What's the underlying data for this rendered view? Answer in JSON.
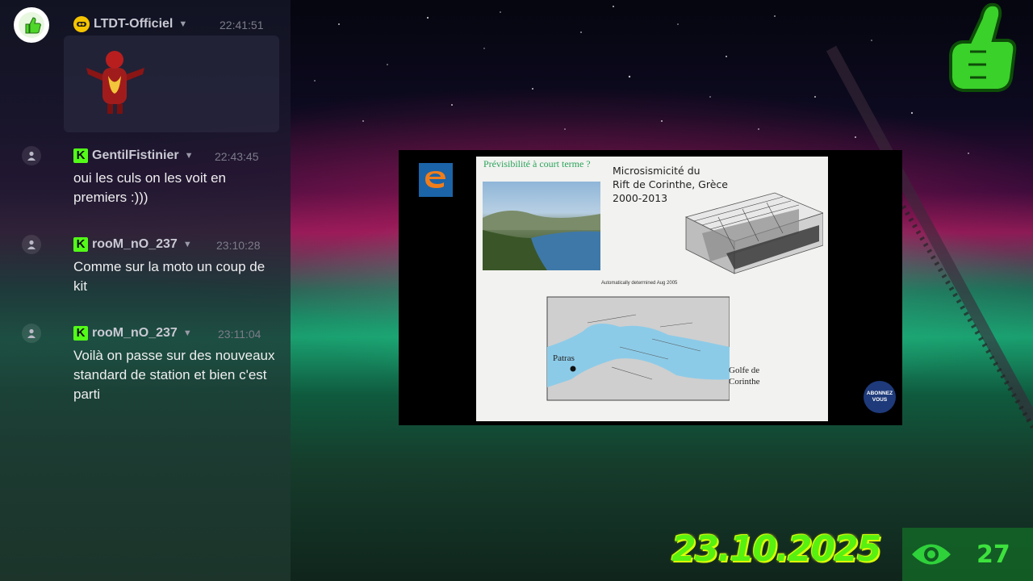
{
  "chat": {
    "messages": [
      {
        "username": "LTDT-Officiel",
        "time": "22:41:51",
        "text": ""
      },
      {
        "username": "GentilFistinier",
        "time": "22:43:45",
        "text": "oui les culs on les voit en premiers :)))"
      },
      {
        "username": "rooM_nO_237",
        "time": "23:10:28",
        "text": "Comme sur la moto un coup de kit"
      },
      {
        "username": "rooM_nO_237",
        "time": "23:11:04",
        "text": "Voilà on passe sur des nouveaux standard de station et bien c'est parti"
      }
    ]
  },
  "slide": {
    "heading": "Prévisibilité  à court terme ?",
    "title_line1": "Microsismicité  du",
    "title_line2": "Rift de Corinthe, Grèce",
    "title_line3": "2000-2013",
    "map_title": "Automatically determined Aug 2005",
    "label_patras": "Patras",
    "label_golfe1": "Golfe de",
    "label_golfe2": "Corinthe",
    "subscribe_line1": "ABONNEZ",
    "subscribe_line2": "VOUS"
  },
  "overlay": {
    "date": "23.10.2025",
    "viewers": "27",
    "accent_green": "#53fc18"
  },
  "icons": {
    "channel_avatar": "thumbs-up-icon",
    "viewer": "eye-icon",
    "user": "user-icon",
    "verified": "kick-badge-icon"
  }
}
